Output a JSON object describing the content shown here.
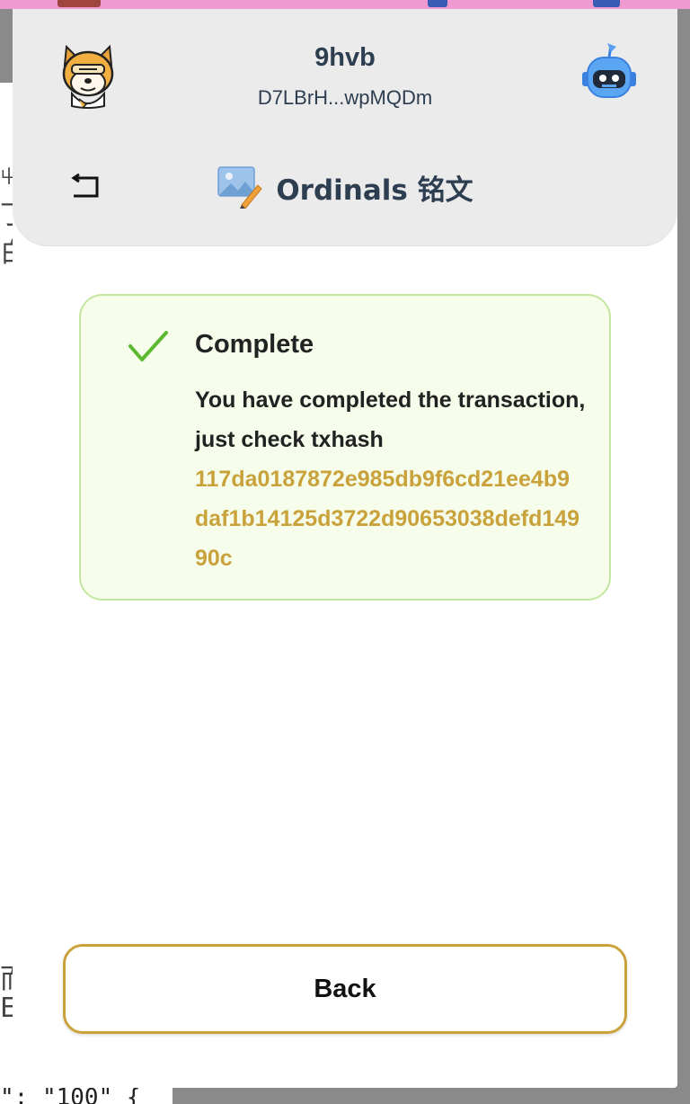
{
  "background": {
    "left_chars": [
      "屮",
      "丁",
      "白",
      "而",
      "E"
    ],
    "bottom_text": "\": \"100\" {"
  },
  "header": {
    "wallet_name": "9hvb",
    "wallet_address": "D7LBrH...wpMQDm",
    "page_title": "Ordinals 铭文",
    "avatar_icon": "shiba-dog-avatar-icon",
    "robot_icon": "robot-icon",
    "back_icon": "return-arrow-icon"
  },
  "result": {
    "status": "Complete",
    "message": "You have completed the transaction, just check txhash",
    "txhash": "117da0187872e985db9f6cd21ee4b9daf1b14125d3722d90653038defd14990c",
    "status_color": "#5cb82f",
    "hash_color": "#c9a23c"
  },
  "footer": {
    "back_label": "Back"
  }
}
